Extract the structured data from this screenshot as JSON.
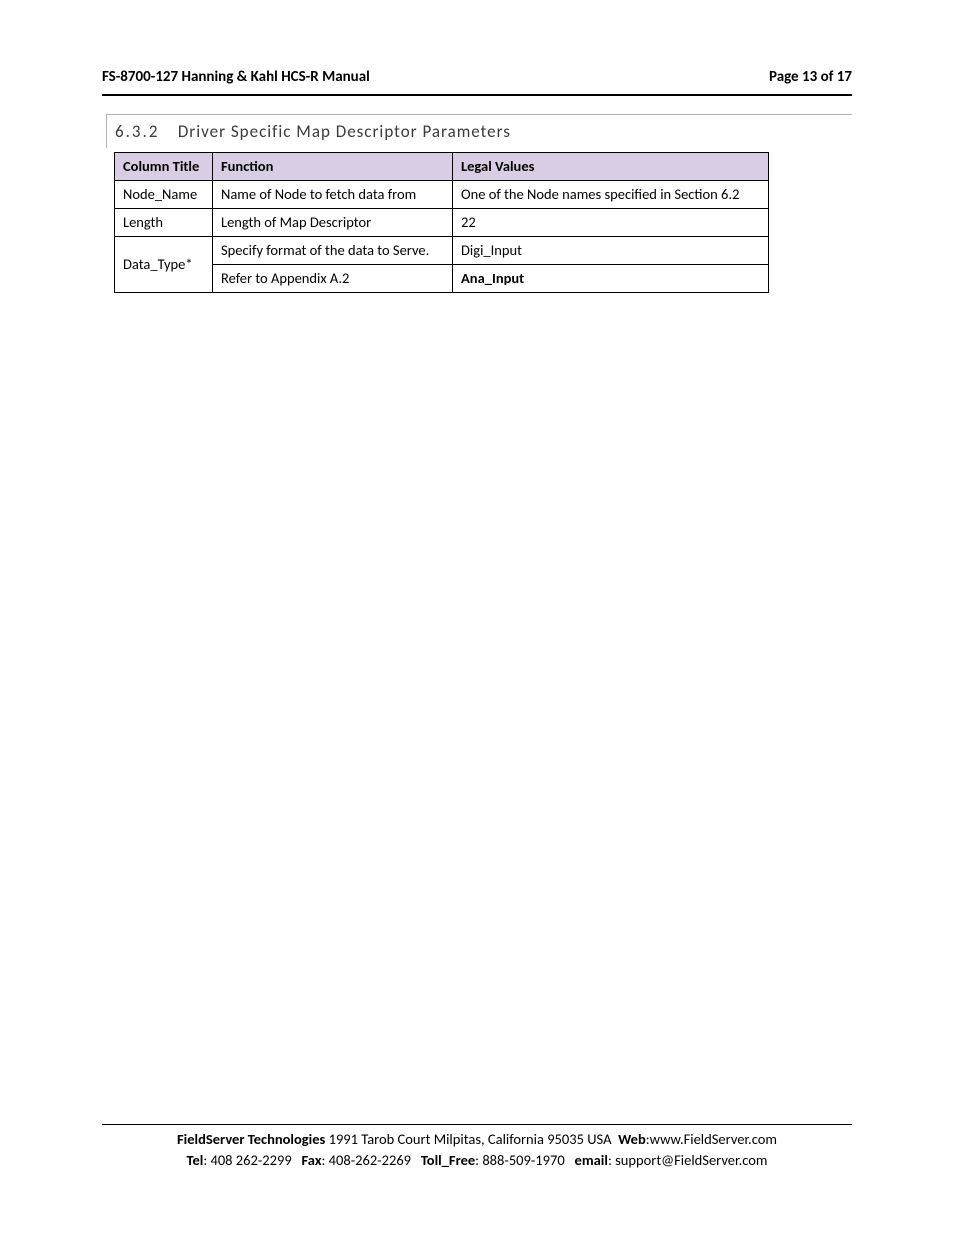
{
  "header": {
    "left": "FS-8700-127 Hanning & Kahl HCS-R Manual",
    "right": "Page 13 of 17"
  },
  "section": {
    "number": "6.3.2",
    "title": "Driver Specific Map Descriptor Parameters"
  },
  "table": {
    "headers": {
      "col1": "Column Title",
      "col2": "Function",
      "col3": "Legal Values"
    },
    "rows": [
      {
        "title": "Node_Name",
        "func": "Name of Node to fetch data from",
        "legal": "One of the Node names specified in Section 6.2"
      },
      {
        "title": "Length",
        "func": "Length of Map Descriptor",
        "legal": "22"
      },
      {
        "title": "Data_Type*",
        "func_line1": "Specify format of the data to Serve.",
        "func_line2": "Refer to Appendix A.2",
        "legal_line1": "Digi_Input",
        "legal_line2": "Ana_Input"
      }
    ]
  },
  "footer": {
    "company": "FieldServer Technologies",
    "address": "1991 Tarob Court Milpitas, California 95035 USA",
    "web_label": "Web",
    "web_value": ":www.FieldServer.com",
    "tel_label": "Tel",
    "tel_value": ": 408 262-2299",
    "fax_label": "Fax",
    "fax_value": ": 408-262-2269",
    "tollfree_label": "Toll_Free",
    "tollfree_value": ": 888-509-1970",
    "email_label": "email",
    "email_value": ": support@FieldServer.com"
  }
}
